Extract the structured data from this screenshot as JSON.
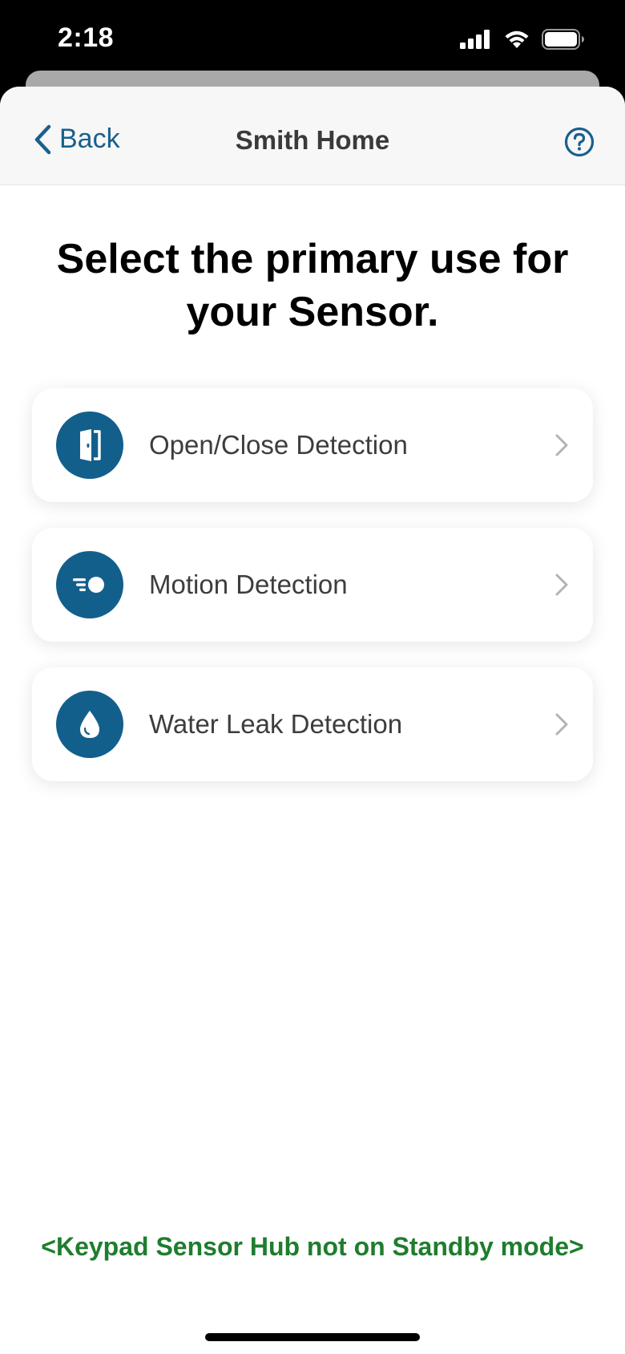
{
  "status_bar": {
    "time": "2:18",
    "icons": [
      "cellular-signal-icon",
      "wifi-icon",
      "battery-icon"
    ]
  },
  "nav": {
    "back_label": "Back",
    "title": "Smith Home",
    "help_icon": "help-icon"
  },
  "heading": {
    "line1": "Select the primary use for",
    "line2": "your Sensor."
  },
  "options": [
    {
      "label": "Open/Close Detection",
      "icon": "door-icon"
    },
    {
      "label": "Motion Detection",
      "icon": "motion-icon"
    },
    {
      "label": "Water Leak Detection",
      "icon": "water-drop-icon"
    }
  ],
  "footer": {
    "note": "<Keypad Sensor Hub not on Standby mode>"
  },
  "colors": {
    "accent": "#135f8c",
    "link": "#1a5f8e",
    "footer_text": "#1e7d2e"
  }
}
